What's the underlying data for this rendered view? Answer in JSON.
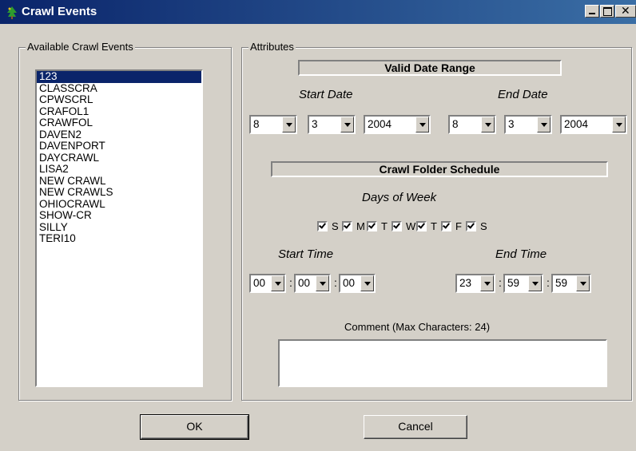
{
  "window": {
    "title": "Crawl Events"
  },
  "available": {
    "label": "Available Crawl Events",
    "items": [
      "123",
      "CLASSCRA",
      "CPWSCRL",
      "CRAFOL1",
      "CRAWFOL",
      "DAVEN2",
      "DAVENPORT",
      "DAYCRAWL",
      "LISA2",
      "NEW CRAWL",
      "NEW CRAWLS",
      "OHIOCRAWL",
      "SHOW-CR",
      "SILLY",
      "TERI10"
    ],
    "selected_index": 0
  },
  "attributes": {
    "label": "Attributes",
    "date_range": {
      "header": "Valid Date Range",
      "start_label": "Start Date",
      "end_label": "End Date",
      "start": {
        "month": "8",
        "day": "3",
        "year": "2004"
      },
      "end": {
        "month": "8",
        "day": "3",
        "year": "2004"
      }
    },
    "schedule": {
      "header": "Crawl Folder Schedule",
      "days_label": "Days of Week",
      "days": [
        {
          "label": "S",
          "checked": true
        },
        {
          "label": "M",
          "checked": true
        },
        {
          "label": "T",
          "checked": true
        },
        {
          "label": "W",
          "checked": true
        },
        {
          "label": "T",
          "checked": true
        },
        {
          "label": "F",
          "checked": true
        },
        {
          "label": "S",
          "checked": true
        }
      ],
      "start_time_label": "Start Time",
      "end_time_label": "End Time",
      "start_time": {
        "h": "00",
        "m": "00",
        "s": "00"
      },
      "end_time": {
        "h": "23",
        "m": "59",
        "s": "59"
      },
      "separator": ":"
    },
    "comment": {
      "label": "Comment (Max Characters: 24)",
      "value": ""
    }
  },
  "buttons": {
    "ok": "OK",
    "cancel": "Cancel"
  },
  "colors": {
    "title_bar": "#0a246a",
    "selection": "#0a246a",
    "face": "#d4d0c8"
  }
}
